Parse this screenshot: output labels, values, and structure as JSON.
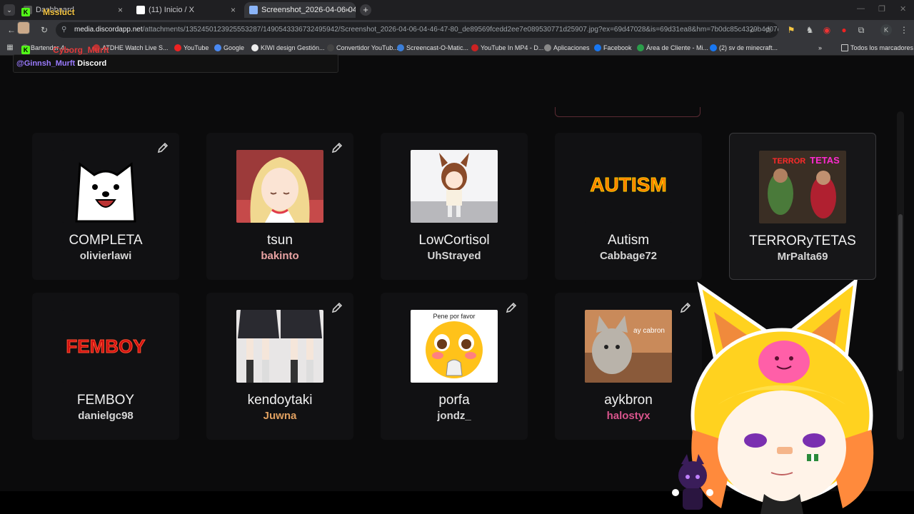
{
  "browser": {
    "tabs": [
      {
        "label": "Dashboard",
        "active": false
      },
      {
        "label": "(11) Inicio / X",
        "active": false
      },
      {
        "label": "Screenshot_2026-04-06-04-46",
        "active": true
      }
    ],
    "close_glyph": "×",
    "new_tab_glyph": "+",
    "tab_menu_glyph": "⌄",
    "url_host": "media.discordapp.net",
    "url_path": "/attachments/1352450123925553287/1490543336732495942/Screenshot_2026-04-06-04-46-47-80_de89569fcedd2ee7e089530771d25907.jpg?ex=69d47028&is=69d31ea8&hm=7b0dc85c4329b4d07d52...",
    "bookmarks": [
      {
        "label": "Bartender 4...",
        "color": "#6a6a6a"
      },
      {
        "label": "ATDHE Watch Live S...",
        "color": "#b33"
      },
      {
        "label": "YouTube",
        "color": "#e22"
      },
      {
        "label": "Google",
        "color": "#4a8af4"
      },
      {
        "label": "KIWI design Gestión...",
        "color": "#eee"
      },
      {
        "label": "Convertidor YouTub...",
        "color": "#444"
      },
      {
        "label": "Screencast-O-Matic...",
        "color": "#3b7ed8"
      },
      {
        "label": "YouTube In MP4 - D...",
        "color": "#c22"
      },
      {
        "label": "Aplicaciones",
        "color": "#888"
      },
      {
        "label": "Facebook",
        "color": "#1877f2"
      },
      {
        "label": "Área de Cliente - Mi...",
        "color": "#2a9d4a"
      },
      {
        "label": "(2) sv de minecraft...",
        "color": "#1877f2"
      }
    ],
    "bookmarks_more": "»",
    "all_bookmarks": "Todos los marcadores",
    "profile_initial": "K"
  },
  "overlay": {
    "streamer_top": "Mssluct",
    "streamer_bottom": "Cyborg_Murft",
    "handle": "@Ginnsh_Murft",
    "platform": "Discord",
    "kick_glyph": "K"
  },
  "cards": [
    {
      "name": "COMPLETA",
      "user": "olivierlawi",
      "user_color": "#d6d6d6",
      "thumb": "dog",
      "editable": true,
      "selected": false
    },
    {
      "name": "tsun",
      "user": "bakinto",
      "user_color": "#e9a3a3",
      "thumb": "anime",
      "editable": true,
      "selected": false
    },
    {
      "name": "LowCortisol",
      "user": "UhStrayed",
      "user_color": "#d6d6d6",
      "thumb": "horsegirl",
      "editable": false,
      "selected": false
    },
    {
      "name": "Autism",
      "user": "Cabbage72",
      "user_color": "#d6d6d6",
      "thumb": "autism-text",
      "editable": false,
      "selected": false
    },
    {
      "name": "TERRORyTETAS",
      "user": "MrPalta69",
      "user_color": "#d6d6d6",
      "thumb": "terror",
      "editable": false,
      "selected": true
    },
    {
      "name": "FEMBOY",
      "user": "danielgc98",
      "user_color": "#d6d6d6",
      "thumb": "femboy-text",
      "editable": false,
      "selected": false
    },
    {
      "name": "kendoytaki",
      "user": "Juwna",
      "user_color": "#e0a060",
      "thumb": "legs",
      "editable": true,
      "selected": false
    },
    {
      "name": "porfa",
      "user": "jondz_",
      "user_color": "#d6d6d6",
      "thumb": "emoji",
      "editable": true,
      "selected": false
    },
    {
      "name": "aykbron",
      "user": "halostyx",
      "user_color": "#d9548c",
      "thumb": "cat",
      "editable": true,
      "selected": false
    }
  ],
  "thumb_text": {
    "autism": "AUTISM",
    "terror_a": "TERROR",
    "terror_b": "TETAS",
    "femboy": "FEMBOY",
    "porfa": "Pene por favor",
    "cat": "ay cabron"
  },
  "colors": {
    "background": "#0b0b0c",
    "card": "#111113",
    "text": "#f1f1f1",
    "overlay_top": "#f5c542",
    "overlay_bottom": "#e23a3a",
    "handle": "#9b7bff"
  }
}
